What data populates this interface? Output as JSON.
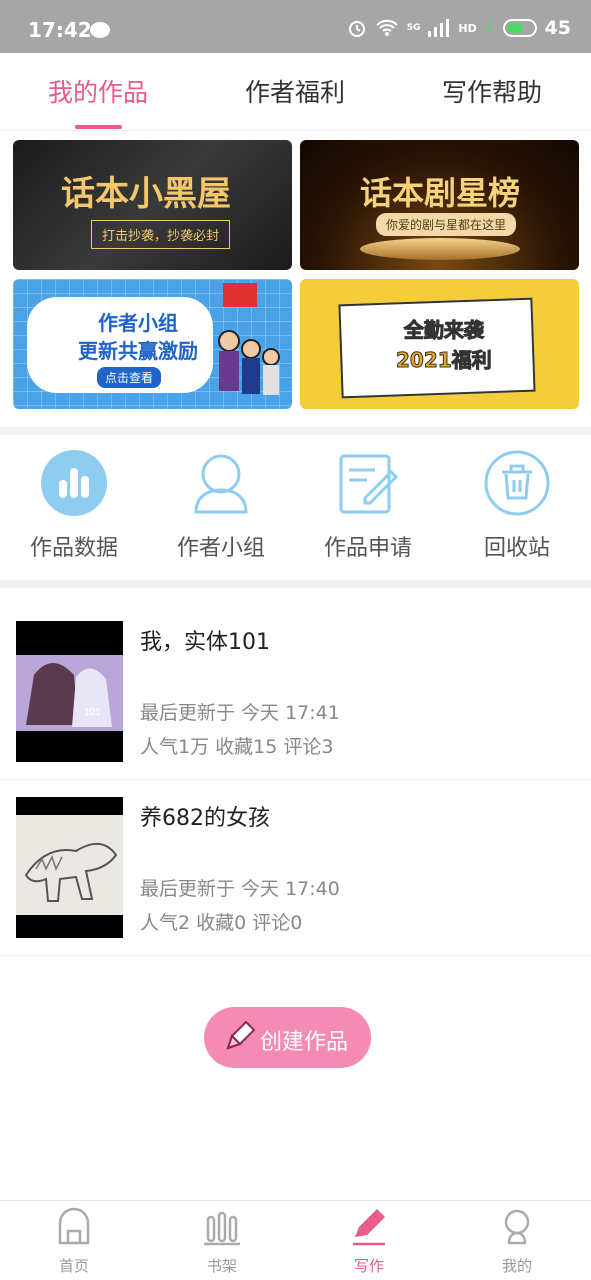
{
  "status_bar": {
    "time": "17:42",
    "network": "5G",
    "hd": "HD",
    "battery": "45"
  },
  "tabs": [
    {
      "label": "我的作品"
    },
    {
      "label": "作者福利"
    },
    {
      "label": "写作帮助"
    }
  ],
  "banners": [
    {
      "title": "话本小黑屋",
      "subtitle": "打击抄袭，抄袭必封"
    },
    {
      "title": "话本剧星榜",
      "subtitle": "你爱的剧与星都在这里"
    },
    {
      "title_line1": "作者小组",
      "title_line2": "更新共赢激励",
      "subtitle": "点击查看"
    },
    {
      "title_line1": "全勤来袭",
      "title_line2": "2021福利"
    }
  ],
  "shortcuts": [
    {
      "label": "作品数据",
      "icon": "bar-chart-icon"
    },
    {
      "label": "作者小组",
      "icon": "group-icon"
    },
    {
      "label": "作品申请",
      "icon": "edit-icon"
    },
    {
      "label": "回收站",
      "icon": "trash-icon"
    }
  ],
  "works": [
    {
      "title": "我，实体101",
      "updated": "最后更新于 今天 17:41",
      "stats": "人气1万 收藏15 评论3",
      "cover_text": "101"
    },
    {
      "title": "养682的女孩",
      "updated": "最后更新于 今天 17:40",
      "stats": "人气2 收藏0 评论0"
    }
  ],
  "create_button": {
    "label": "创建作品"
  },
  "bottom_nav": [
    {
      "label": "首页",
      "icon": "home-icon"
    },
    {
      "label": "书架",
      "icon": "bookshelf-icon"
    },
    {
      "label": "写作",
      "icon": "pen-icon"
    },
    {
      "label": "我的",
      "icon": "profile-icon"
    }
  ],
  "colors": {
    "accent": "#e95b8c",
    "button": "#f48bb4",
    "icon_blue": "#8fcdf0"
  }
}
